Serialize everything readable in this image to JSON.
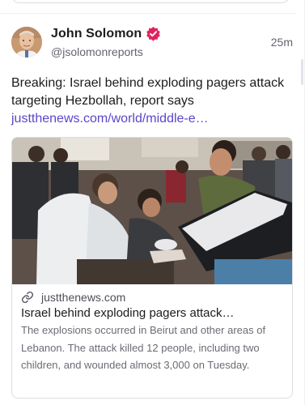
{
  "post": {
    "author_name": "John Solomon",
    "author_handle": "@jsolomonreports",
    "timestamp": "25m",
    "body_text": "Breaking: Israel behind exploding pagers attack targeting Hezbollah, report says",
    "body_link": "justthenews.com/world/middle-e…",
    "avatar_icon": "avatar-photo",
    "verified_icon": "verified-badge-icon",
    "verified_color": "#e0245e"
  },
  "link_card": {
    "domain": "justthenews.com",
    "title": "Israel behind exploding pagers attack…",
    "description": "The explosions occurred in Beirut and other areas of Lebanon. The attack killed 12 people, including two children, and wounded almost 3,000 on Tuesday.",
    "link_icon": "chain-link-icon"
  },
  "colors": {
    "link": "#5b46c9",
    "secondary_text": "#62656f",
    "border": "#dcdde3"
  }
}
